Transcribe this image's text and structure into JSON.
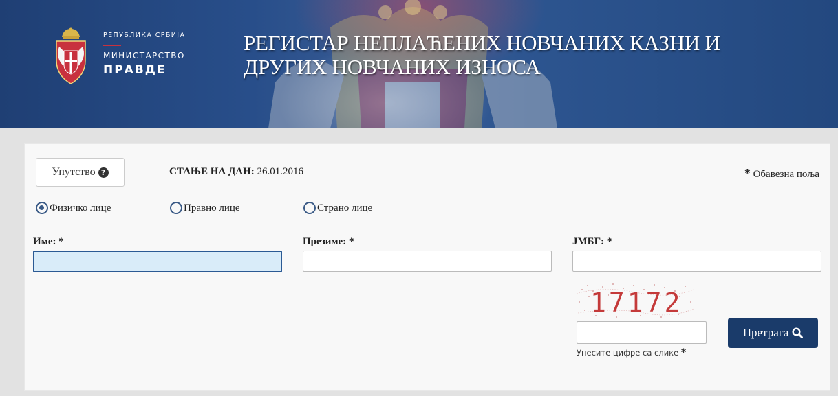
{
  "header": {
    "republic": "РЕПУБЛИКА СРБИЈА",
    "ministry": "МИНИСТАРСТВО",
    "ministry_name": "ПРАВДЕ",
    "title_line1": "РЕГИСТАР НЕПЛАЋЕНИХ НОВЧАНИХ КАЗНИ И",
    "title_line2": "ДРУГИХ НОВЧАНИХ ИЗНОСА"
  },
  "toolbar": {
    "instructions_label": "Упутство",
    "instructions_icon": "question-circle-icon",
    "state_label": "СТАЊЕ НА ДАН:",
    "state_date": "26.01.2016",
    "required_star": "*",
    "required_label": "Обавезна поља"
  },
  "person_type": {
    "options": [
      {
        "label": "Физичко лице",
        "selected": true
      },
      {
        "label": "Правно лице",
        "selected": false
      },
      {
        "label": "Страно лице",
        "selected": false
      }
    ]
  },
  "form": {
    "first_name_label": "Име:",
    "last_name_label": "Презиме:",
    "jmbg_label": "ЈМБГ:",
    "required_mark": "*",
    "first_name_value": "",
    "last_name_value": "",
    "jmbg_value": ""
  },
  "captcha": {
    "digits": "17172",
    "hint": "Унесите цифре са слике",
    "required_mark": "*",
    "value": ""
  },
  "search": {
    "label": "Претрага",
    "icon": "search-icon"
  },
  "colors": {
    "primary_button": "#1a3b6a",
    "radio": "#3a5a86",
    "focused_input_bg": "#d9ecf9",
    "captcha_text": "#c43a3a",
    "divider_red": "#c8313e"
  }
}
